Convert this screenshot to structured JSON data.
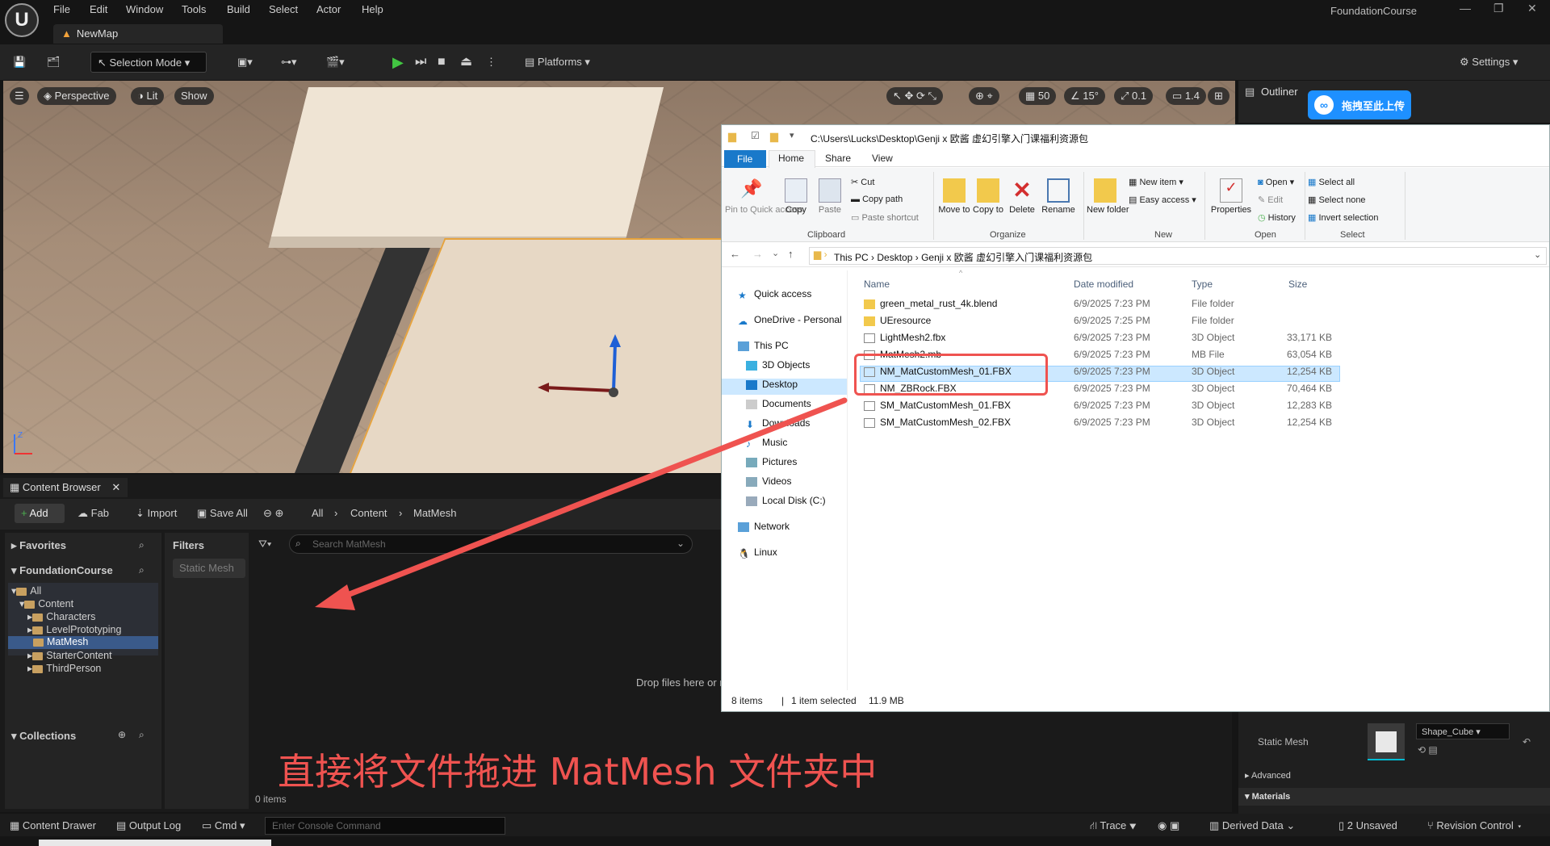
{
  "menu": [
    "File",
    "Edit",
    "Window",
    "Tools",
    "Build",
    "Select",
    "Actor",
    "Help"
  ],
  "app_title": "FoundationCourse",
  "map_tab": "NewMap",
  "toolbar": {
    "selection_mode": "Selection Mode",
    "platforms": "Platforms",
    "settings": "Settings"
  },
  "viewport": {
    "perspective": "Perspective",
    "lit": "Lit",
    "show": "Show",
    "grid_snap": "50",
    "angle_snap": "15°",
    "scale_snap": "0.1",
    "camera_speed": "1.4"
  },
  "content_browser": {
    "tab": "Content Browser",
    "add": "Add",
    "fab": "Fab",
    "import": "Import",
    "save_all": "Save All",
    "breadcrumb": [
      "All",
      "Content",
      "MatMesh"
    ],
    "favorites": "Favorites",
    "project": "FoundationCourse",
    "tree": [
      "All",
      "Content",
      "Characters",
      "LevelPrototyping",
      "MatMesh",
      "StarterContent",
      "ThirdPerson"
    ],
    "collections": "Collections",
    "filters": "Filters",
    "static_mesh_filter": "Static Mesh",
    "search_placeholder": "Search MatMesh",
    "drop_text": "Drop files here or r",
    "items_count": "0 items"
  },
  "caption": "直接将文件拖进 MatMesh 文件夹中",
  "statusbar": {
    "content_drawer": "Content Drawer",
    "output_log": "Output Log",
    "cmd": "Cmd",
    "console_placeholder": "Enter Console Command",
    "trace": "Trace",
    "derived_data": "Derived Data",
    "unsaved": "2 Unsaved",
    "revision_control": "Revision Control"
  },
  "outliner": {
    "title": "Outliner"
  },
  "baidu_button": "拖拽至此上传",
  "details": {
    "static_mesh_label": "Static Mesh",
    "static_mesh_value": "Shape_Cube",
    "advanced": "Advanced",
    "materials": "Materials"
  },
  "explorer": {
    "title_path": "C:\\Users\\Lucks\\Desktop\\Genji x 欧酱 虚幻引擎入门课福利资源包",
    "tabs": [
      "File",
      "Home",
      "Share",
      "View"
    ],
    "ribbon": {
      "pin": "Pin to Quick access",
      "copy": "Copy",
      "paste": "Paste",
      "cut": "Cut",
      "copy_path": "Copy path",
      "paste_shortcut": "Paste shortcut",
      "clipboard": "Clipboard",
      "move_to": "Move to",
      "copy_to": "Copy to",
      "delete": "Delete",
      "rename": "Rename",
      "organize": "Organize",
      "new_folder": "New folder",
      "new_item": "New item",
      "easy_access": "Easy access",
      "new": "New",
      "properties": "Properties",
      "open": "Open",
      "edit": "Edit",
      "history": "History",
      "open_group": "Open",
      "select_all": "Select all",
      "select_none": "Select none",
      "invert_selection": "Invert selection",
      "select_group": "Select"
    },
    "address": [
      "This PC",
      "Desktop",
      "Genji x 欧酱 虚幻引擎入门课福利资源包"
    ],
    "nav": [
      "Quick access",
      "OneDrive - Personal",
      "This PC",
      "3D Objects",
      "Desktop",
      "Documents",
      "Downloads",
      "Music",
      "Pictures",
      "Videos",
      "Local Disk (C:)",
      "Network",
      "Linux"
    ],
    "columns": [
      "Name",
      "Date modified",
      "Type",
      "Size"
    ],
    "files": [
      {
        "name": "green_metal_rust_4k.blend",
        "date": "6/9/2025 7:23 PM",
        "type": "File folder",
        "size": ""
      },
      {
        "name": "UEresource",
        "date": "6/9/2025 7:25 PM",
        "type": "File folder",
        "size": ""
      },
      {
        "name": "LightMesh2.fbx",
        "date": "6/9/2025 7:23 PM",
        "type": "3D Object",
        "size": "33,171 KB"
      },
      {
        "name": "MatMesh2.mb",
        "date": "6/9/2025 7:23 PM",
        "type": "MB File",
        "size": "63,054 KB"
      },
      {
        "name": "NM_MatCustomMesh_01.FBX",
        "date": "6/9/2025 7:23 PM",
        "type": "3D Object",
        "size": "12,254 KB"
      },
      {
        "name": "NM_ZBRock.FBX",
        "date": "6/9/2025 7:23 PM",
        "type": "3D Object",
        "size": "70,464 KB"
      },
      {
        "name": "SM_MatCustomMesh_01.FBX",
        "date": "6/9/2025 7:23 PM",
        "type": "3D Object",
        "size": "12,283 KB"
      },
      {
        "name": "SM_MatCustomMesh_02.FBX",
        "date": "6/9/2025 7:23 PM",
        "type": "3D Object",
        "size": "12,254 KB"
      }
    ],
    "status_items": "8 items",
    "status_selected": "1 item selected",
    "status_size": "11.9 MB"
  },
  "colors": {
    "accent": "#1979ca",
    "annotation": "#ef5350",
    "play": "#42c642",
    "selection_outline": "#e6a23c"
  }
}
